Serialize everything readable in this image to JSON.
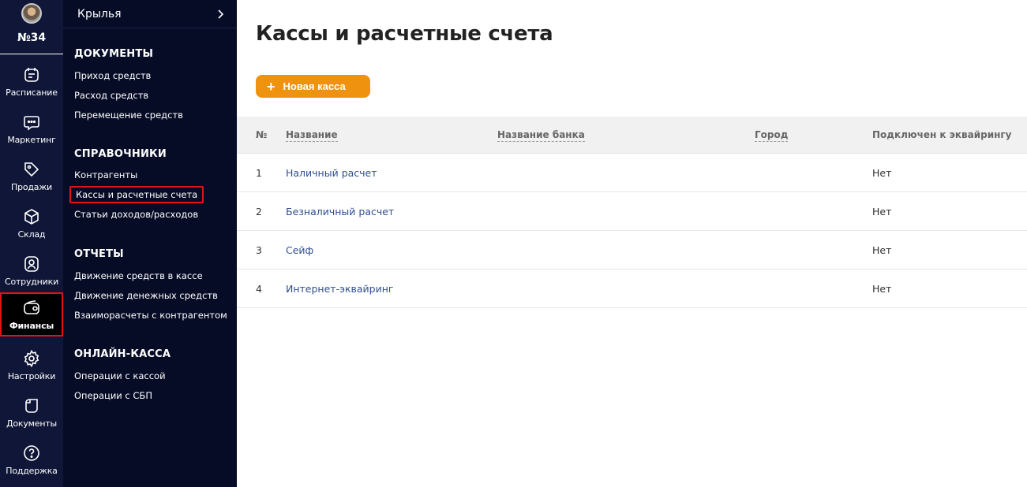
{
  "rail": {
    "branch": "№34",
    "items": [
      {
        "label": "Расписание",
        "icon": "calendar-icon"
      },
      {
        "label": "Маркетинг",
        "icon": "chat-bubble-icon"
      },
      {
        "label": "Продажи",
        "icon": "tag-icon"
      },
      {
        "label": "Склад",
        "icon": "box-icon"
      },
      {
        "label": "Сотрудники",
        "icon": "user-badge-icon"
      },
      {
        "label": "Финансы",
        "icon": "wallet-icon"
      },
      {
        "label": "Настройки",
        "icon": "gear-icon"
      },
      {
        "label": "Документы",
        "icon": "document-icon"
      },
      {
        "label": "Поддержка",
        "icon": "help-icon"
      }
    ]
  },
  "submenu": {
    "company": "Крылья",
    "sections": [
      {
        "title": "ДОКУМЕНТЫ",
        "links": [
          "Приход средств",
          "Расход средств",
          "Перемещение средств"
        ]
      },
      {
        "title": "СПРАВОЧНИКИ",
        "links": [
          "Контрагенты",
          "Кассы и расчетные счета",
          "Статьи доходов/расходов"
        ]
      },
      {
        "title": "ОТЧЕТЫ",
        "links": [
          "Движение средств в кассе",
          "Движение денежных средств",
          "Взаиморасчеты с контрагентом"
        ]
      },
      {
        "title": "ОНЛАЙН-КАССА",
        "links": [
          "Операции с кассой",
          "Операции с СБП"
        ]
      }
    ]
  },
  "main": {
    "title": "Кассы и расчетные счета",
    "add_button": "Новая касса",
    "table": {
      "headers": [
        "№",
        "Название",
        "Название банка",
        "Город",
        "Подключен к эквайрингу"
      ],
      "rows": [
        [
          "1",
          "Наличный расчет",
          "",
          "",
          "Нет"
        ],
        [
          "2",
          "Безналичный расчет",
          "",
          "",
          "Нет"
        ],
        [
          "3",
          "Сейф",
          "",
          "",
          "Нет"
        ],
        [
          "4",
          "Интернет-эквайринг",
          "",
          "",
          "Нет"
        ]
      ]
    }
  },
  "colors": {
    "rail_bg": "#0f1637",
    "submenu_bg": "#070c26",
    "accent": "#ef9210",
    "highlight": "#e11414",
    "link": "#2f4f8f"
  }
}
